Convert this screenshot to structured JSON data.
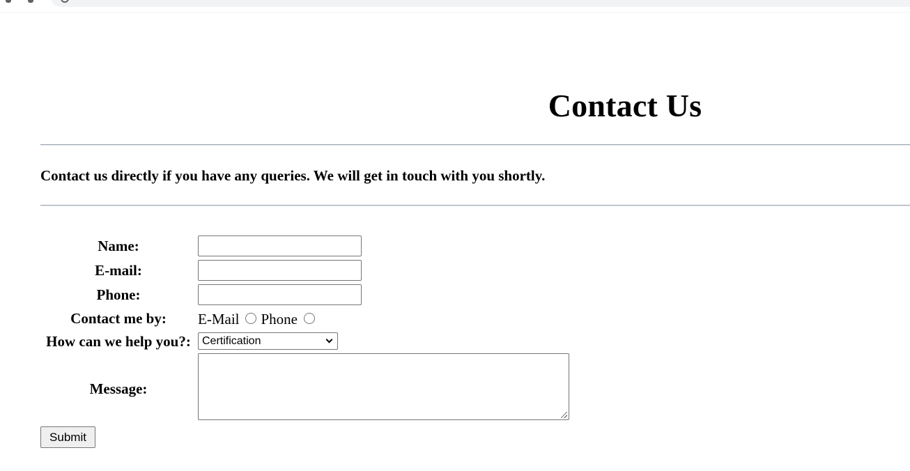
{
  "page": {
    "title": "Contact Us",
    "intro": "Contact us directly if you have any queries. We will get in touch with you shortly."
  },
  "form": {
    "name_label": "Name:",
    "name_value": "",
    "email_label": "E-mail:",
    "email_value": "",
    "phone_label": "Phone:",
    "phone_value": "",
    "contact_by_label": "Contact me by:",
    "contact_options": [
      {
        "label": "E-Mail",
        "checked": false
      },
      {
        "label": "Phone",
        "checked": false
      }
    ],
    "help_label": "How can we help you?:",
    "help_selected": "Certification",
    "message_label": "Message:",
    "message_value": "",
    "submit_label": "Submit"
  },
  "icons": {
    "select_arrow": "chevron-down-icon",
    "textarea_resize": "resize-handle-icon"
  }
}
